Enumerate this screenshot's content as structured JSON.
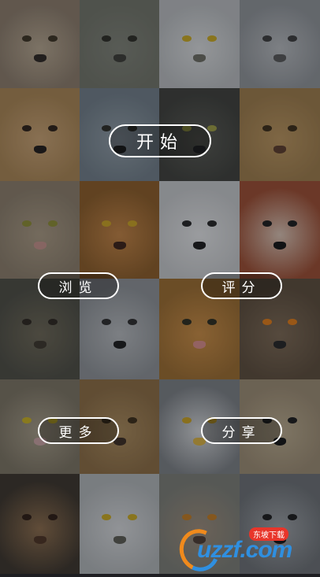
{
  "buttons": {
    "start": "开始",
    "browse": "浏览",
    "rate": "评分",
    "more": "更多",
    "share": "分享"
  },
  "watermark": {
    "brand": "uzzf.com",
    "sub": "东坡下载"
  },
  "tiles": [
    {
      "name": "tiger-tile",
      "bg": "#8a7a68",
      "face": "#b4a48c",
      "eye": "#3a3020",
      "nose": "#2a2420"
    },
    {
      "name": "monkey-tile",
      "bg": "#6f7266",
      "face": "#7d8074",
      "eye": "#2a2a22",
      "nose": "#3a3a34"
    },
    {
      "name": "owl-tile",
      "bg": "#b8bbbd",
      "face": "#d8dadb",
      "eye": "#c8a820",
      "nose": "#6a6a60"
    },
    {
      "name": "white-tiger-tile",
      "bg": "#8e9296",
      "face": "#b5b8bb",
      "eye": "#3a3a3a",
      "nose": "#555"
    },
    {
      "name": "dog-tile",
      "bg": "#a88350",
      "face": "#c7a070",
      "eye": "#2a1e14",
      "nose": "#1e1a16"
    },
    {
      "name": "wolf-tile",
      "bg": "#6f7c86",
      "face": "#8e9aa3",
      "eye": "#2a2a24",
      "nose": "#1e1e1e"
    },
    {
      "name": "panther-tile",
      "bg": "#3c3d38",
      "face": "#55564e",
      "eye": "#9a9a40",
      "nose": "#222"
    },
    {
      "name": "lion-tile",
      "bg": "#9c7a48",
      "face": "#b8925a",
      "eye": "#3a2a14",
      "nose": "#5a3a28"
    },
    {
      "name": "cat-tile",
      "bg": "#8a7c68",
      "face": "#a89880",
      "eye": "#8a8a30",
      "nose": "#c49088"
    },
    {
      "name": "tiger-cub-tile",
      "bg": "#8a5a24",
      "face": "#c08040",
      "eye": "#c8a020",
      "nose": "#3a2014"
    },
    {
      "name": "polar-bear-tile",
      "bg": "#c4c6c8",
      "face": "#e2e3e4",
      "eye": "#222",
      "nose": "#1a1a1a"
    },
    {
      "name": "red-panda-tile",
      "bg": "#9a4a2e",
      "face": "#d8c0b0",
      "eye": "#1a1a1a",
      "nose": "#111"
    },
    {
      "name": "chimp-tile",
      "bg": "#4a4a40",
      "face": "#6a6452",
      "eye": "#2a241c",
      "nose": "#3a3428"
    },
    {
      "name": "grey-wolf-tile",
      "bg": "#8c9094",
      "face": "#b4b7ba",
      "eye": "#2a2a2a",
      "nose": "#1a1a1a"
    },
    {
      "name": "roaring-tiger-tile",
      "bg": "#9a6a2c",
      "face": "#c88a40",
      "eye": "#2a2a1c",
      "nose": "#d88a88"
    },
    {
      "name": "eagle-owl-tile",
      "bg": "#5a4a38",
      "face": "#7a6650",
      "eye": "#e07a14",
      "nose": "#222"
    },
    {
      "name": "owl-open-beak-tile",
      "bg": "#7a7260",
      "face": "#a49a84",
      "eye": "#c8b020",
      "nose": "#c8a0a0"
    },
    {
      "name": "roaring-lion-tile",
      "bg": "#8a6a40",
      "face": "#a88858",
      "eye": "#3a2a14",
      "nose": "#3a2a20"
    },
    {
      "name": "eagle-tile",
      "bg": "#7a7e82",
      "face": "#d2d4d6",
      "eye": "#c8a020",
      "nose": "#d8b040"
    },
    {
      "name": "pug-tile",
      "bg": "#9a8a70",
      "face": "#b8a88a",
      "eye": "#1a1a1a",
      "nose": "#111"
    },
    {
      "name": "baby-chimp-tile",
      "bg": "#3a3228",
      "face": "#8a6a48",
      "eye": "#2a1a10",
      "nose": "#4a3020"
    },
    {
      "name": "snowy-owl-tile",
      "bg": "#b0b4b6",
      "face": "#d4d6d8",
      "eye": "#c8a820",
      "nose": "#5a5a50"
    },
    {
      "name": "macaque-tile",
      "bg": "#7a7c74",
      "face": "#9a8a78",
      "eye": "#c07a20",
      "nose": "#4a3a30"
    },
    {
      "name": "raccoon-tile",
      "bg": "#6a6e72",
      "face": "#9a9ea2",
      "eye": "#1a1a1a",
      "nose": "#111"
    }
  ]
}
